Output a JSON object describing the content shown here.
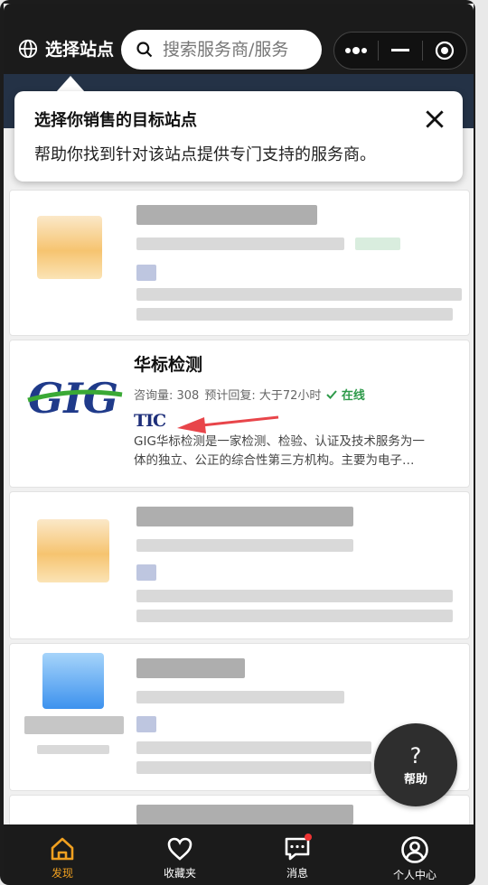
{
  "header": {
    "site_label": "选择站点",
    "search_placeholder": "搜索服务商/服务"
  },
  "tooltip": {
    "title": "选择你销售的目标站点",
    "text": "帮助你找到针对该站点提供专门支持的服务商。"
  },
  "featured_card": {
    "logo_text": "GIG",
    "name": "华标检测",
    "inquiries_label": "咨询量: 308",
    "reply_label": "预计回复: 大于72小时",
    "online_label": "在线",
    "badge": "TIC",
    "description_line1": "GIG华标检测是一家检测、检验、认证及技术服务为一",
    "description_line2": "体的独立、公正的综合性第三方机构。主要为电子…"
  },
  "help": {
    "icon": "?",
    "label": "帮助"
  },
  "bottom_nav": [
    {
      "label": "发现",
      "icon": "home-icon",
      "active": true
    },
    {
      "label": "收藏夹",
      "icon": "heart-icon",
      "active": false
    },
    {
      "label": "消息",
      "icon": "message-icon",
      "active": false
    },
    {
      "label": "个人中心",
      "icon": "user-icon",
      "active": false
    }
  ],
  "colors": {
    "accent": "#f0a020",
    "online": "#2e9a4a",
    "arrow": "#e8454a",
    "gig_blue": "#1f3a8a",
    "gig_green": "#3aa935"
  }
}
